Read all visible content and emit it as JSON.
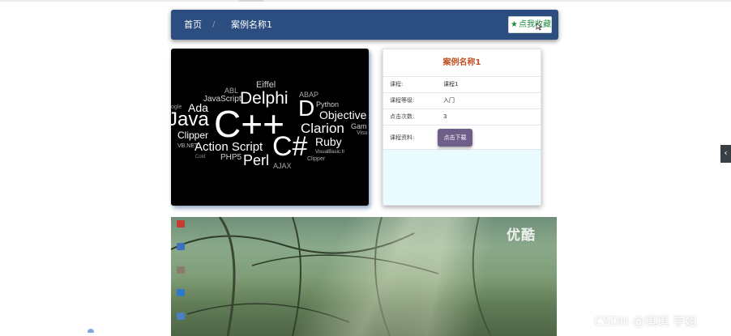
{
  "breadcrumb": {
    "home": "首页",
    "separator": "/",
    "current": "案例名称1"
  },
  "favorite_button": {
    "icon": "star-icon",
    "label": "点我收藏"
  },
  "course_image": {
    "words": [
      "Eiffel",
      "ABL",
      "ABAP",
      "JavaScript",
      "Delphi",
      "D",
      "Python",
      "Ada",
      "Objective",
      "Java",
      "C++",
      "Clarion",
      "Gam",
      "Clipper",
      "Visu",
      "Ruby",
      "C#",
      "Action Script",
      "VB.NET",
      "VisualBasic.II",
      "PHP5",
      "Perl",
      "AJAX",
      "Clipper",
      "Cold",
      "ogle"
    ]
  },
  "info_panel": {
    "title": "案例名称1",
    "rows": [
      {
        "label": "课程:",
        "value": "课程1"
      },
      {
        "label": "课程等级:",
        "value": "入门"
      },
      {
        "label": "点击次数:",
        "value": "3"
      }
    ],
    "material_label": "课程资料:",
    "download_button": "点击下载"
  },
  "video": {
    "logo": "优酷"
  },
  "watermark": "CSDN @琪琪 学姐",
  "colors": {
    "navbar": "#2b4d80",
    "title_accent": "#c05324",
    "download_button": "#6d5f87",
    "favorite_text": "#1f8b3f",
    "panel_bg": "#eafbff"
  }
}
